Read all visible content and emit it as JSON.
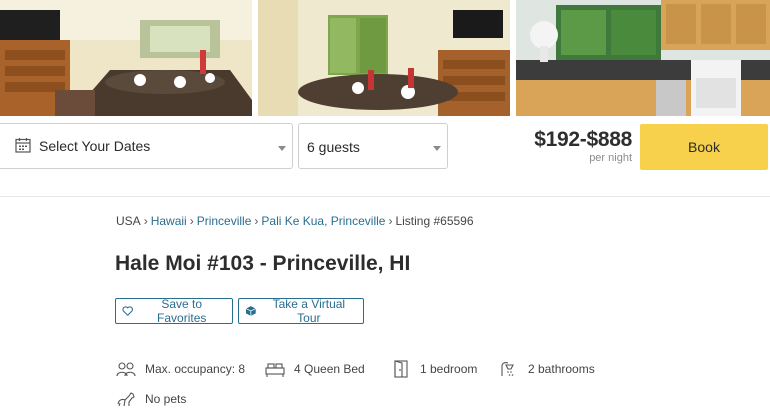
{
  "booking": {
    "dates_label": "Select Your Dates",
    "guests_value": "6 guests",
    "price_range": "$192-$888",
    "price_unit": "per night",
    "book_label": "Book"
  },
  "breadcrumb": {
    "items": [
      "USA",
      "Hawaii",
      "Princeville",
      "Pali Ke Kua, Princeville",
      "Listing #65596"
    ],
    "separator": "›"
  },
  "listing": {
    "title": "Hale Moi #103 - Princeville, HI",
    "save_label": "Save to Favorites",
    "tour_label": "Take a Virtual Tour"
  },
  "amenities": {
    "occupancy": "Max. occupancy: 8",
    "beds": "4 Queen Bed",
    "bedrooms": "1 bedroom",
    "bathrooms": "2 bathrooms",
    "pets": "No pets"
  },
  "colors": {
    "accent_link": "#2a6e8f",
    "book_button": "#f7d14b"
  }
}
